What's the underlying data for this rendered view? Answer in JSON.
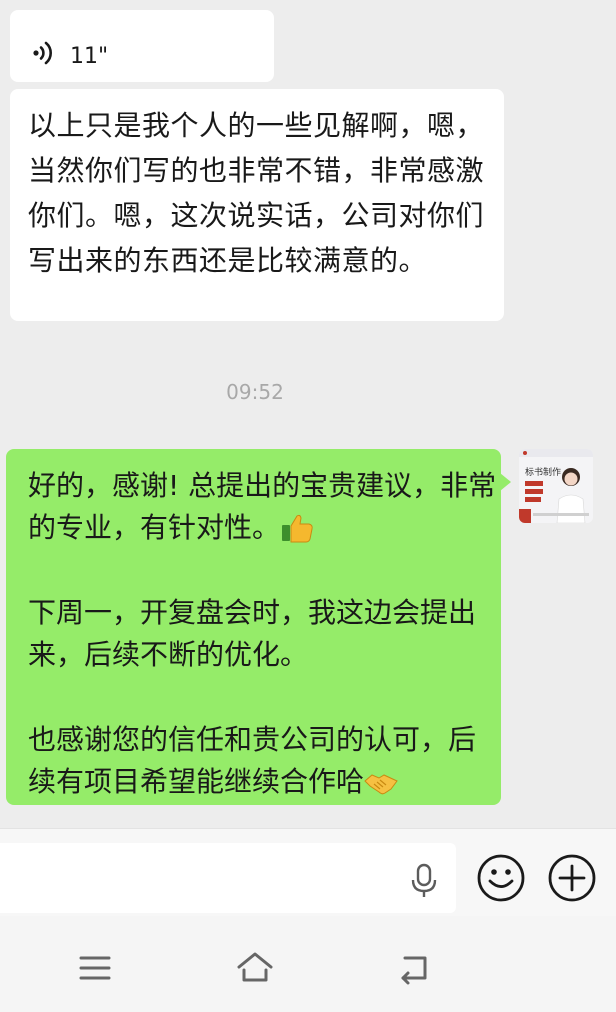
{
  "messages": {
    "voice": {
      "duration": "11\"",
      "icon": "voice-wave-icon"
    },
    "received_text": {
      "text": "以上只是我个人的一些见解啊，嗯，当然你们写的也非常不错，非常感激你们。嗯，这次说实话，公司对你们写出来的东西还是比较满意的。"
    },
    "timestamp": "09:52",
    "sent": {
      "paragraph1": "好的，感谢! 总提出的宝贵建议，非常的专业，有针对性。",
      "paragraph2": "下周一，开复盘会时，我这边会提出来，后续不断的优化。",
      "paragraph3": "也感谢您的信任和贵公司的认可，后续有项目希望能继续合作哈",
      "emoji1": "thumbs-up-emoji",
      "emoji2": "handshake-emoji",
      "bubble_color": "#95ec69"
    },
    "avatar": {
      "title": "标书制作"
    }
  },
  "input_bar": {
    "voice_icon": "microphone-icon",
    "emoji_icon": "smiley-face-icon",
    "plus_icon": "plus-circle-icon"
  },
  "nav": {
    "menu_icon": "menu-icon",
    "home_icon": "home-icon",
    "back_icon": "back-icon"
  },
  "colors": {
    "background": "#ededed",
    "received_bubble": "#ffffff",
    "sent_bubble": "#95ec69",
    "timestamp": "#a8a8a8"
  }
}
